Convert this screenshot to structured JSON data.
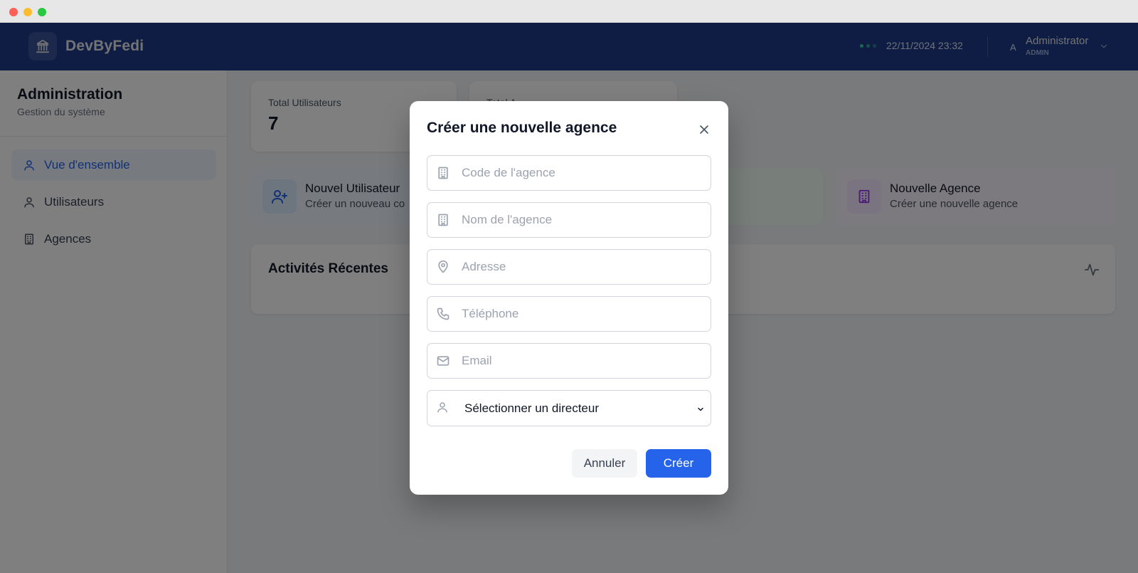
{
  "header": {
    "brand": "DevByFedi",
    "datetime": "22/11/2024 23:32",
    "user_initial": "A",
    "user_name": "Administrator",
    "user_role": "ADMIN",
    "brand_color": "#1e3a8a"
  },
  "sidebar": {
    "title": "Administration",
    "subtitle": "Gestion du système",
    "items": [
      {
        "label": "Vue d'ensemble",
        "icon": "user-icon",
        "active": true
      },
      {
        "label": "Utilisateurs",
        "icon": "user-icon",
        "active": false
      },
      {
        "label": "Agences",
        "icon": "building-icon",
        "active": false
      }
    ]
  },
  "main": {
    "stats": [
      {
        "label": "Total Utilisateurs",
        "value": "7"
      },
      {
        "label": "Total A"
      }
    ],
    "actions": [
      {
        "title": "Nouvel Utilisateur",
        "subtitle": "Créer un nouveau co",
        "icon": "user-plus-icon"
      },
      {
        "title": "Nouvelle Agence",
        "subtitle": "Créer une nouvelle agence",
        "icon": "building-icon"
      }
    ],
    "activity": {
      "title": "Activités Récentes",
      "icon": "activity-icon"
    }
  },
  "modal": {
    "title": "Créer une nouvelle agence",
    "fields": {
      "code": {
        "placeholder": "Code de l'agence",
        "icon": "building-icon"
      },
      "name": {
        "placeholder": "Nom de l'agence",
        "icon": "building-icon"
      },
      "address": {
        "placeholder": "Adresse",
        "icon": "map-pin-icon"
      },
      "phone": {
        "placeholder": "Téléphone",
        "icon": "phone-icon"
      },
      "email": {
        "placeholder": "Email",
        "icon": "mail-icon"
      },
      "director": {
        "selected": "Sélectionner un directeur",
        "icon": "user-icon"
      }
    },
    "cancel_label": "Annuler",
    "create_label": "Créer",
    "accent_color": "#2563eb"
  }
}
